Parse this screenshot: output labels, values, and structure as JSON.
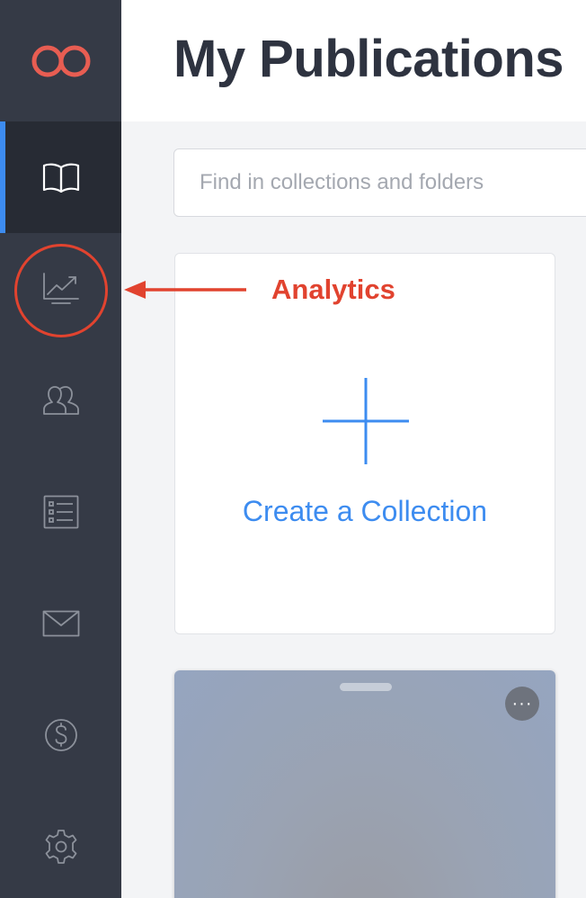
{
  "header": {
    "title": "My Publications"
  },
  "search": {
    "placeholder": "Find in collections and folders"
  },
  "create_card": {
    "label": "Create a Collection"
  },
  "publication_card": {
    "more_label": "···"
  },
  "sidebar": {
    "items": [
      {
        "name": "library",
        "icon": "book-icon",
        "active": true
      },
      {
        "name": "analytics",
        "icon": "chart-line-icon",
        "active": false
      },
      {
        "name": "audience",
        "icon": "users-icon",
        "active": false
      },
      {
        "name": "lists",
        "icon": "checklist-icon",
        "active": false
      },
      {
        "name": "mail",
        "icon": "envelope-icon",
        "active": false
      },
      {
        "name": "billing",
        "icon": "dollar-icon",
        "active": false
      },
      {
        "name": "settings",
        "icon": "gear-icon",
        "active": false
      }
    ]
  },
  "annotation": {
    "label": "Analytics"
  },
  "colors": {
    "accent": "#3d8cf0",
    "sidebar": "#353a46",
    "sidebar_active": "#272b34",
    "logo": "#e85d52",
    "annotation": "#e1432f"
  }
}
